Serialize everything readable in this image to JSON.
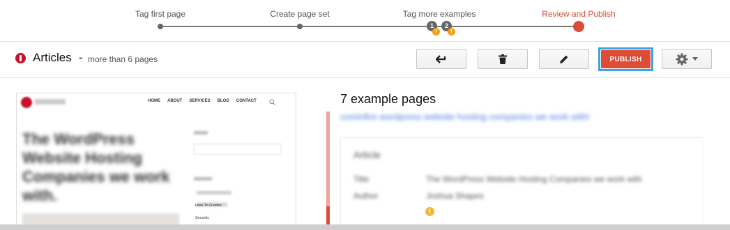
{
  "stepper": {
    "steps": [
      {
        "label": "Tag first page"
      },
      {
        "label": "Create page set"
      },
      {
        "label": "Tag more examples"
      },
      {
        "label": "Review and Publish"
      }
    ],
    "badges": [
      "1",
      "2"
    ],
    "warning_glyph": "!",
    "active_color": "#dc4c36"
  },
  "header": {
    "title": "Articles",
    "separator": "-",
    "subtitle": "more than 6 pages",
    "buttons": {
      "back_icon": "arrow-left-icon",
      "delete_icon": "trash-icon",
      "edit_icon": "pencil-icon",
      "publish_label": "PUBLISH",
      "settings_icon": "gear-icon"
    },
    "accent_color": "#3ba2e6"
  },
  "preview": {
    "nav": [
      "HOME",
      "ABOUT",
      "SERVICES",
      "BLOG",
      "CONTACT"
    ],
    "headline": "The WordPress Website Hosting Companies we work with.",
    "sidebar_items": [
      "How-To Guides",
      "Security"
    ]
  },
  "examples": {
    "heading": "7 example pages",
    "link": "cominfire wordpress website hosting companies we work with/",
    "card": {
      "type": "Article",
      "fields": [
        {
          "label": "Title",
          "value": "The WordPress Website Hosting Companies we work with"
        },
        {
          "label": "Author",
          "value": "Joshua Shapes"
        }
      ],
      "warning_glyph": "!"
    }
  }
}
